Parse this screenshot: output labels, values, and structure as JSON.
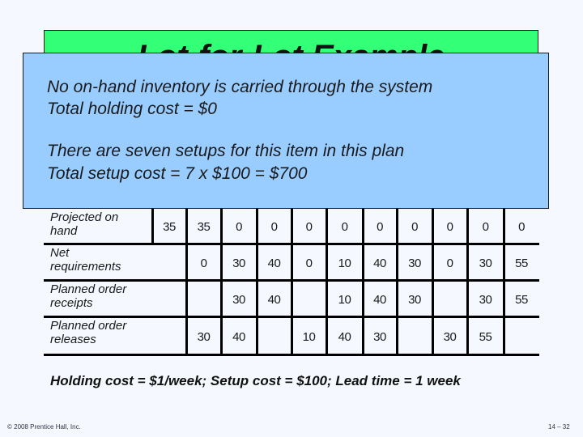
{
  "slide": {
    "title": "Lot-for-Lot Example",
    "notes": [
      "No on-hand inventory is carried through the system",
      "Total holding cost = $0",
      "There are seven setups for this item in this plan",
      "Total setup cost = 7 x $100 = $700"
    ],
    "table": {
      "rows": [
        {
          "label": "Projected on\nhand",
          "values": [
            "35",
            "35",
            "0",
            "0",
            "0",
            "0",
            "0",
            "0",
            "0",
            "0",
            "0"
          ],
          "start_col": 0
        },
        {
          "label": "Net\nrequirements",
          "values": [
            "0",
            "30",
            "40",
            "0",
            "10",
            "40",
            "30",
            "0",
            "30",
            "55"
          ],
          "start_col": 1
        },
        {
          "label": "Planned order\nreceipts",
          "values": [
            "",
            "30",
            "40",
            "",
            "10",
            "40",
            "30",
            "",
            "30",
            "55"
          ],
          "start_col": 1
        },
        {
          "label": "Planned order\nreleases",
          "values": [
            "30",
            "40",
            "",
            "10",
            "40",
            "30",
            "",
            "30",
            "55",
            ""
          ],
          "start_col": 1
        }
      ]
    },
    "bottom_note": "Holding cost = $1/week; Setup cost = $100; Lead time = 1 week",
    "copyright": "© 2008 Prentice Hall, Inc.",
    "page_number": "14 – 32"
  }
}
